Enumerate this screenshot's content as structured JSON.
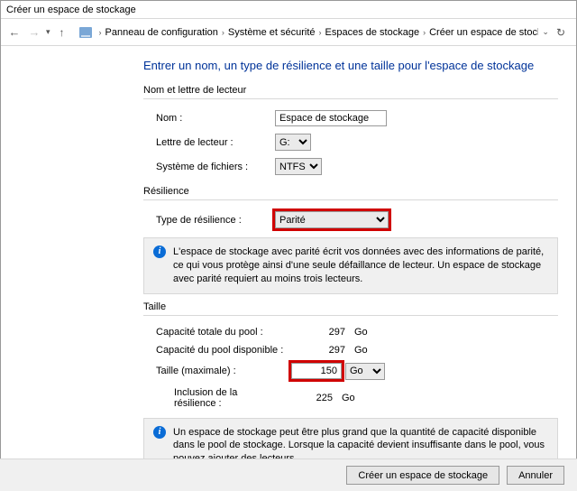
{
  "window": {
    "title": "Créer un espace de stockage"
  },
  "breadcrumb": {
    "items": [
      "Panneau de configuration",
      "Système et sécurité",
      "Espaces de stockage",
      "Créer un espace de stockage"
    ]
  },
  "heading": "Entrer un nom, un type de résilience et une taille pour l'espace de stockage",
  "group_name": {
    "title": "Nom et lettre de lecteur",
    "name_label": "Nom :",
    "name_value": "Espace de stockage",
    "drive_label": "Lettre de lecteur :",
    "drive_value": "G:",
    "fs_label": "Système de fichiers :",
    "fs_value": "NTFS"
  },
  "group_res": {
    "title": "Résilience",
    "type_label": "Type de résilience :",
    "type_value": "Parité",
    "info": "L'espace de stockage avec parité écrit vos données avec des informations de parité, ce qui vous protège ainsi d'une seule défaillance de lecteur. Un espace de stockage avec parité requiert au moins trois lecteurs."
  },
  "group_size": {
    "title": "Taille",
    "total_label": "Capacité totale du pool :",
    "total_value": "297",
    "total_unit": "Go",
    "avail_label": "Capacité du pool disponible :",
    "avail_value": "297",
    "avail_unit": "Go",
    "max_label": "Taille (maximale) :",
    "max_value": "150",
    "max_unit": "Go",
    "incl_label": "Inclusion de la résilience :",
    "incl_value": "225",
    "incl_unit": "Go",
    "info": "Un espace de stockage peut être plus grand que la quantité de capacité disponible dans le pool de stockage. Lorsque la capacité devient insuffisante dans le pool, vous pouvez ajouter des lecteurs."
  },
  "footer": {
    "create": "Créer un espace de stockage",
    "cancel": "Annuler"
  }
}
